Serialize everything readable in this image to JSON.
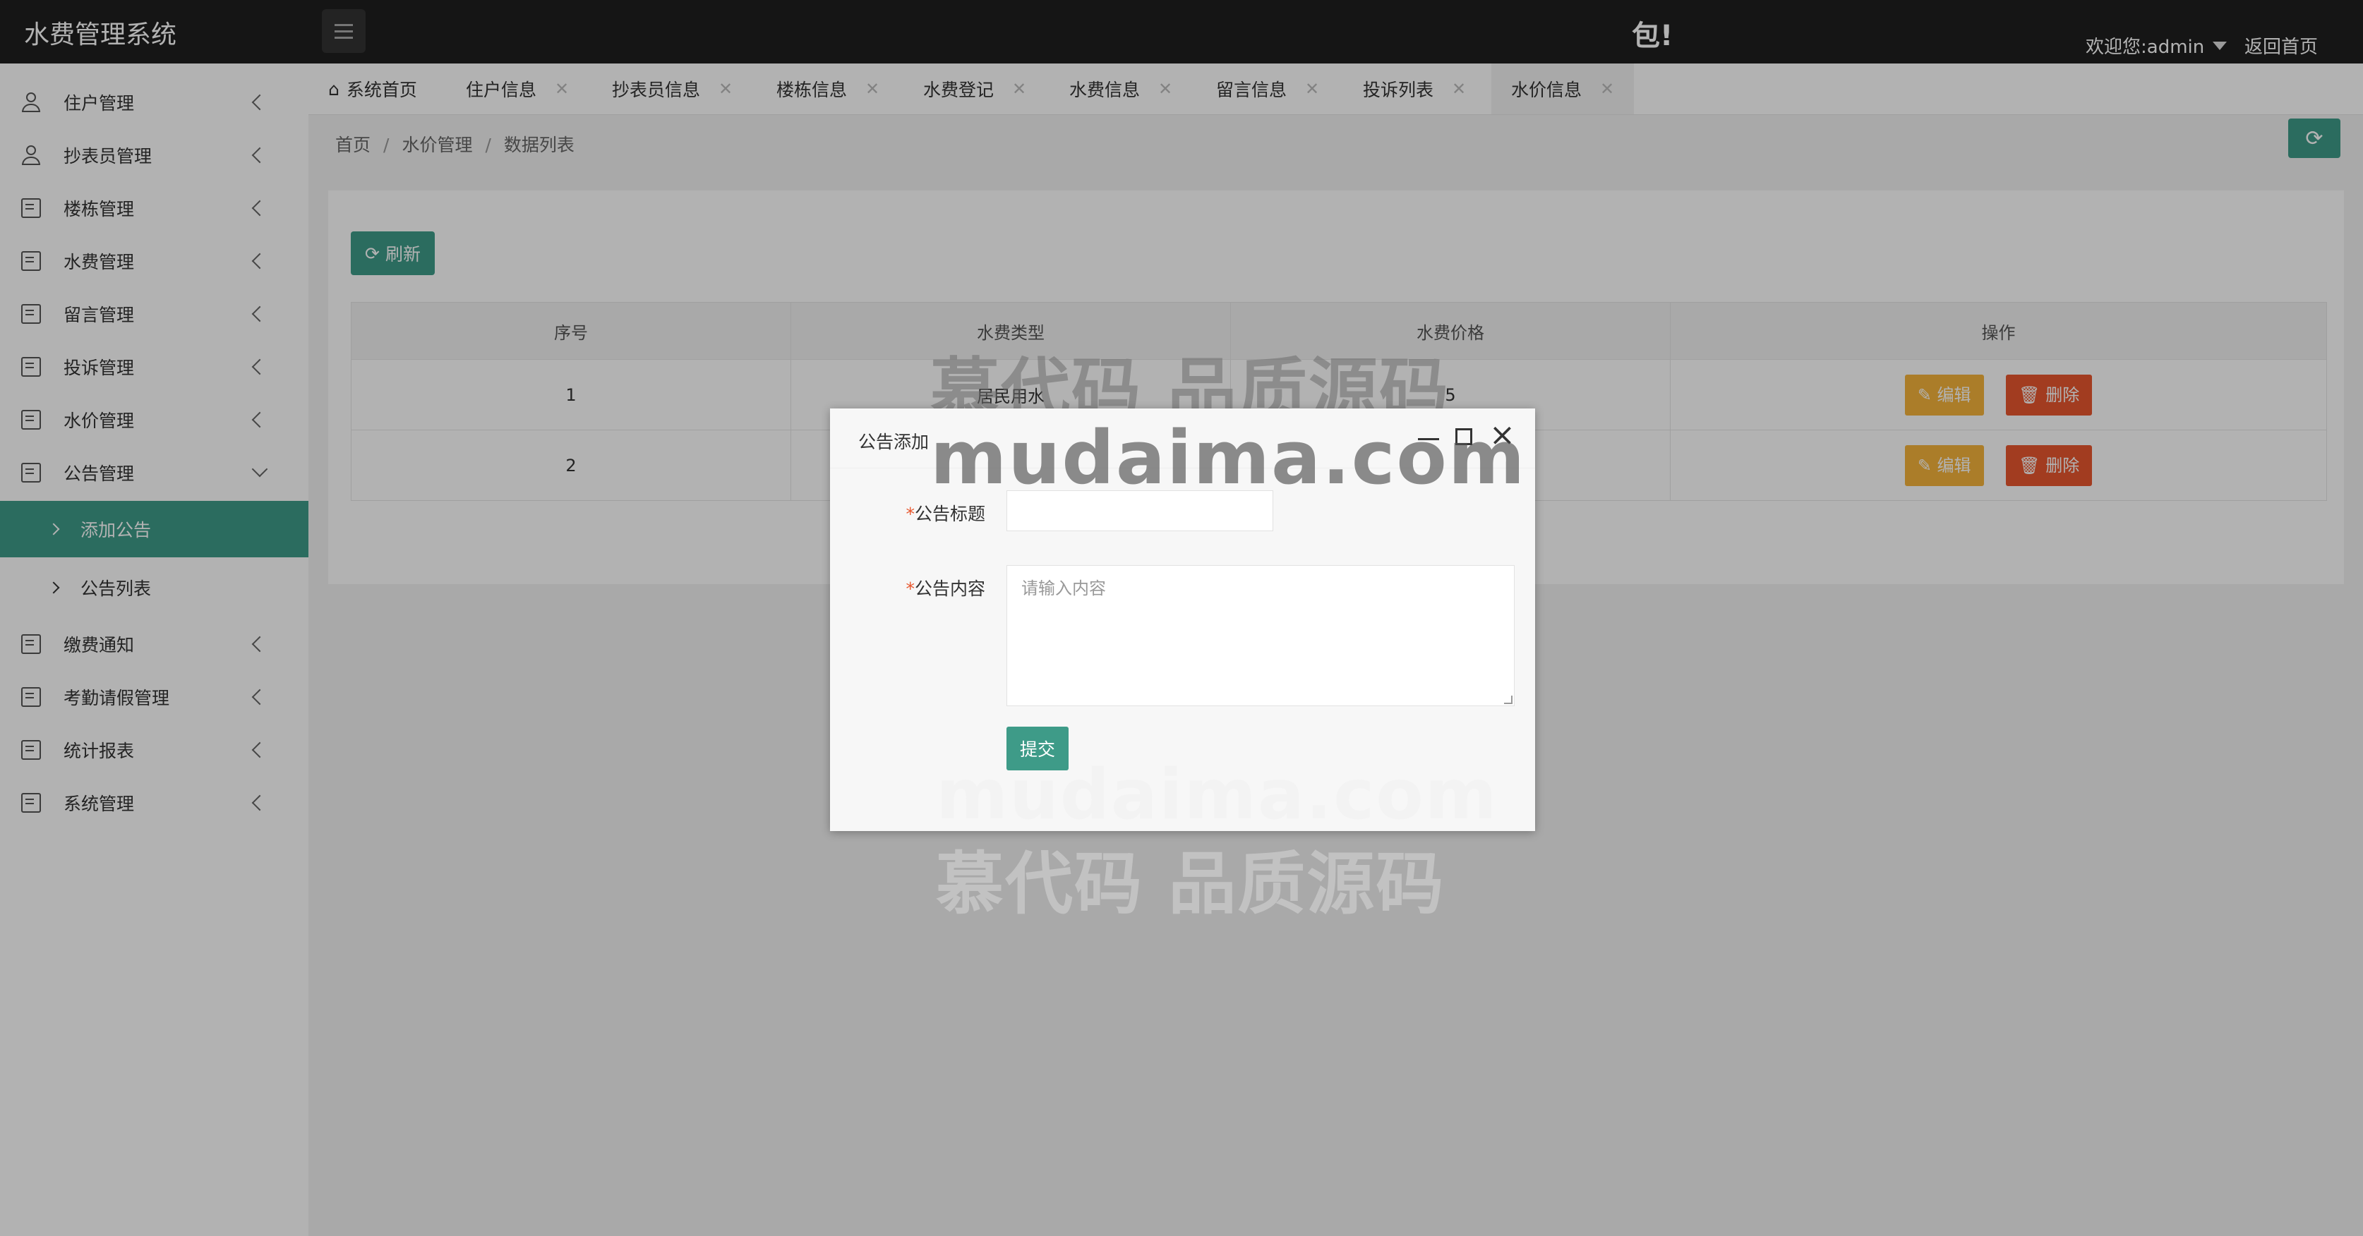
{
  "header": {
    "app_title": "水费管理系统",
    "banner_text": "包!",
    "user_greeting": "欢迎您:admin",
    "home_link": "返回首页"
  },
  "sidebar": {
    "items": [
      {
        "label": "住户管理",
        "icon": "user-icon"
      },
      {
        "label": "抄表员管理",
        "icon": "user-icon"
      },
      {
        "label": "楼栋管理",
        "icon": "document-icon"
      },
      {
        "label": "水费管理",
        "icon": "document-icon"
      },
      {
        "label": "留言管理",
        "icon": "document-icon"
      },
      {
        "label": "投诉管理",
        "icon": "document-icon"
      },
      {
        "label": "水价管理",
        "icon": "document-icon"
      },
      {
        "label": "公告管理",
        "icon": "document-icon"
      },
      {
        "label": "缴费通知",
        "icon": "document-icon"
      },
      {
        "label": "考勤请假管理",
        "icon": "document-icon"
      },
      {
        "label": "统计报表",
        "icon": "document-icon"
      },
      {
        "label": "系统管理",
        "icon": "document-icon"
      }
    ],
    "subitems": [
      {
        "label": "添加公告",
        "active": true
      },
      {
        "label": "公告列表",
        "active": false
      }
    ]
  },
  "tabs": [
    {
      "label": "系统首页"
    },
    {
      "label": "住户信息"
    },
    {
      "label": "抄表员信息"
    },
    {
      "label": "楼栋信息"
    },
    {
      "label": "水费登记"
    },
    {
      "label": "水费信息"
    },
    {
      "label": "留言信息"
    },
    {
      "label": "投诉列表"
    },
    {
      "label": "水价信息"
    }
  ],
  "breadcrumb": [
    "首页",
    "水价管理",
    "数据列表"
  ],
  "toolbar": {
    "refresh_label": "刷新"
  },
  "table": {
    "columns": [
      "序号",
      "水费类型",
      "水费价格",
      "操作"
    ],
    "rows": [
      {
        "index": "1",
        "type": "居民用水",
        "price": "5"
      },
      {
        "index": "2",
        "type": "",
        "price": ""
      }
    ],
    "edit_label": "编辑",
    "delete_label": "删除"
  },
  "dialog": {
    "title": "公告添加",
    "title_label": "公告标题",
    "content_label": "公告内容",
    "content_placeholder": "请输入内容",
    "submit_label": "提交"
  },
  "watermark": {
    "line1": "慕代码 品质源码",
    "line2": "mudaima.com"
  },
  "colors": {
    "accent": "#3e9b88",
    "topbar": "#1f1f1f",
    "edit": "#f5b43c",
    "delete": "#e8572e"
  }
}
